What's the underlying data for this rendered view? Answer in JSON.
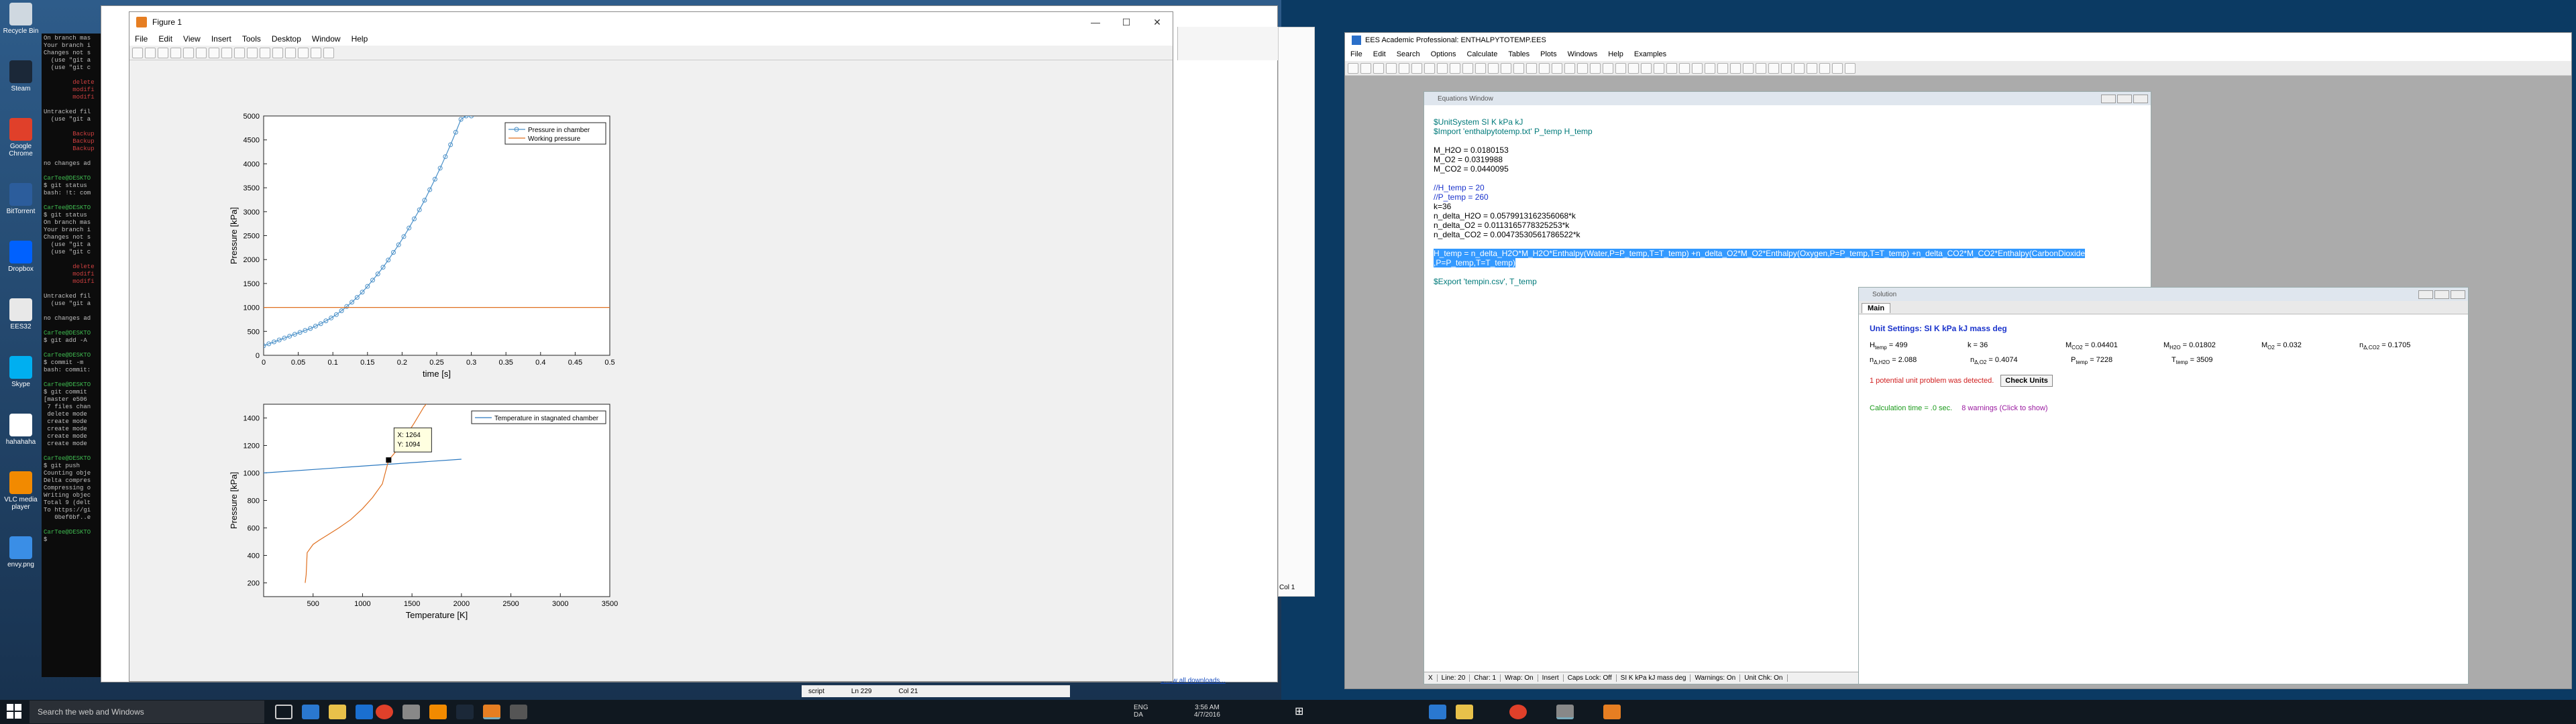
{
  "desktop_left": {
    "icons": [
      {
        "label": "Recycle Bin",
        "icon": "recycle-bin-icon",
        "color": "#cfd8e0"
      },
      {
        "label": "Steam",
        "icon": "steam-icon",
        "color": "#1b2838"
      },
      {
        "label": "Google Chrome",
        "icon": "chrome-icon",
        "color": "#e0402a"
      },
      {
        "label": "BitTorrent",
        "icon": "bittorrent-icon",
        "color": "#2c5d9c"
      },
      {
        "label": "Dropbox",
        "icon": "dropbox-icon",
        "color": "#0061fe"
      },
      {
        "label": "EES32",
        "icon": "ees32-icon",
        "color": "#e8e8e8"
      },
      {
        "label": "Skype",
        "icon": "skype-icon",
        "color": "#00aff0"
      },
      {
        "label": "hahahaha",
        "icon": "file-icon",
        "color": "#ffffff"
      },
      {
        "label": "VLC media player",
        "icon": "vlc-icon",
        "color": "#f28a00"
      },
      {
        "label": "envy.png",
        "icon": "image-file-icon",
        "color": "#3a8ee6"
      }
    ]
  },
  "terminal": {
    "lines": [
      {
        "t": "On branch mas",
        "c": ""
      },
      {
        "t": "Your branch i",
        "c": ""
      },
      {
        "t": "Changes not s",
        "c": ""
      },
      {
        "t": "  (use \"git a",
        "c": ""
      },
      {
        "t": "  (use \"git c",
        "c": ""
      },
      {
        "t": "",
        "c": ""
      },
      {
        "t": "        delete",
        "c": "r"
      },
      {
        "t": "        modifi",
        "c": "r"
      },
      {
        "t": "        modifi",
        "c": "r"
      },
      {
        "t": "",
        "c": ""
      },
      {
        "t": "Untracked fil",
        "c": ""
      },
      {
        "t": "  (use \"git a",
        "c": ""
      },
      {
        "t": "",
        "c": ""
      },
      {
        "t": "        Backup",
        "c": "r"
      },
      {
        "t": "        Backup",
        "c": "r"
      },
      {
        "t": "        Backup",
        "c": "r"
      },
      {
        "t": "",
        "c": ""
      },
      {
        "t": "no changes ad",
        "c": ""
      },
      {
        "t": "",
        "c": ""
      },
      {
        "t": "CarTee@DESKTO",
        "c": "g"
      },
      {
        "t": "$ git status",
        "c": ""
      },
      {
        "t": "bash: !t: com",
        "c": ""
      },
      {
        "t": "",
        "c": ""
      },
      {
        "t": "CarTee@DESKTO",
        "c": "g"
      },
      {
        "t": "$ git status",
        "c": ""
      },
      {
        "t": "On branch mas",
        "c": ""
      },
      {
        "t": "Your branch i",
        "c": ""
      },
      {
        "t": "Changes not s",
        "c": ""
      },
      {
        "t": "  (use \"git a",
        "c": ""
      },
      {
        "t": "  (use \"git c",
        "c": ""
      },
      {
        "t": "",
        "c": ""
      },
      {
        "t": "        delete",
        "c": "r"
      },
      {
        "t": "        modifi",
        "c": "r"
      },
      {
        "t": "        modifi",
        "c": "r"
      },
      {
        "t": "",
        "c": ""
      },
      {
        "t": "Untracked fil",
        "c": ""
      },
      {
        "t": "  (use \"git a",
        "c": ""
      },
      {
        "t": "",
        "c": ""
      },
      {
        "t": "no changes ad",
        "c": ""
      },
      {
        "t": "",
        "c": ""
      },
      {
        "t": "CarTee@DESKTO",
        "c": "g"
      },
      {
        "t": "$ git add -A",
        "c": ""
      },
      {
        "t": "",
        "c": ""
      },
      {
        "t": "CarTee@DESKTO",
        "c": "g"
      },
      {
        "t": "$ commit -m ",
        "c": ""
      },
      {
        "t": "bash: commit:",
        "c": ""
      },
      {
        "t": "",
        "c": ""
      },
      {
        "t": "CarTee@DESKTO",
        "c": "g"
      },
      {
        "t": "$ git commit",
        "c": ""
      },
      {
        "t": "[master e506",
        "c": ""
      },
      {
        "t": " 7 files chan",
        "c": ""
      },
      {
        "t": " delete mode",
        "c": ""
      },
      {
        "t": " create mode",
        "c": ""
      },
      {
        "t": " create mode",
        "c": ""
      },
      {
        "t": " create mode",
        "c": ""
      },
      {
        "t": " create mode",
        "c": ""
      },
      {
        "t": "",
        "c": ""
      },
      {
        "t": "CarTee@DESKTO",
        "c": "g"
      },
      {
        "t": "$ git push",
        "c": ""
      },
      {
        "t": "Counting obje",
        "c": ""
      },
      {
        "t": "Delta compres",
        "c": ""
      },
      {
        "t": "Compressing o",
        "c": ""
      },
      {
        "t": "Writing objec",
        "c": ""
      },
      {
        "t": "Total 9 (delt",
        "c": ""
      },
      {
        "t": "To https://gi",
        "c": ""
      },
      {
        "t": "   0bef0bf..e",
        "c": ""
      },
      {
        "t": "",
        "c": ""
      },
      {
        "t": "CarTee@DESKTO",
        "c": "g"
      },
      {
        "t": "$ ",
        "c": ""
      }
    ]
  },
  "matlab_figure": {
    "title": "Figure 1",
    "menu": [
      "File",
      "Edit",
      "View",
      "Insert",
      "Tools",
      "Desktop",
      "Window",
      "Help"
    ],
    "window_controls": [
      "—",
      "☐",
      "✕"
    ]
  },
  "chart_data": [
    {
      "type": "line",
      "xlabel": "time [s]",
      "ylabel": "Pressure [kPa]",
      "xlim": [
        0,
        0.5
      ],
      "ylim": [
        0,
        5000
      ],
      "xticks": [
        "0",
        "0.05",
        "0.1",
        "0.15",
        "0.2",
        "0.25",
        "0.3",
        "0.35",
        "0.4",
        "0.45",
        "0.5"
      ],
      "yticks": [
        "0",
        "500",
        "1000",
        "1500",
        "2000",
        "2500",
        "3000",
        "3500",
        "4000",
        "4500",
        "5000"
      ],
      "legend": "top-right",
      "series": [
        {
          "name": "Pressure in chamber",
          "color": "#4a90c8",
          "marker": "circle",
          "x": [
            0,
            0.0075,
            0.015,
            0.0225,
            0.03,
            0.0375,
            0.045,
            0.0525,
            0.06,
            0.0675,
            0.075,
            0.0825,
            0.09,
            0.0975,
            0.105,
            0.1125,
            0.12,
            0.1275,
            0.135,
            0.1425,
            0.15,
            0.1575,
            0.165,
            0.1725,
            0.18,
            0.1875,
            0.195,
            0.2025,
            0.21,
            0.2175,
            0.225,
            0.2325,
            0.24,
            0.2475,
            0.255,
            0.2625,
            0.27,
            0.2775,
            0.285,
            0.2925,
            0.3
          ],
          "y": [
            200,
            240,
            280,
            320,
            360,
            400,
            440,
            480,
            520,
            560,
            610,
            660,
            720,
            780,
            850,
            930,
            1020,
            1110,
            1210,
            1320,
            1440,
            1570,
            1700,
            1840,
            1990,
            2150,
            2310,
            2480,
            2660,
            2850,
            3040,
            3240,
            3460,
            3680,
            3910,
            4150,
            4400,
            4660,
            4930,
            5000,
            5000
          ]
        },
        {
          "name": "Working pressure",
          "color": "#e07020",
          "marker": "none",
          "x": [
            0,
            0.5
          ],
          "y": [
            1000,
            1000
          ]
        }
      ]
    },
    {
      "type": "line",
      "xlabel": "Temperature [K]",
      "ylabel": "Pressure [kPa]",
      "xlim": [
        0,
        3500
      ],
      "ylim": [
        100,
        1500
      ],
      "xticks": [
        "500",
        "1000",
        "1500",
        "2000",
        "2500",
        "3000",
        "3500"
      ],
      "yticks": [
        "200",
        "400",
        "600",
        "800",
        "1000",
        "1200",
        "1400"
      ],
      "legend": "top-right",
      "series": [
        {
          "name": "Temperature in stagnated chamber",
          "color": "#2a78c0",
          "marker": "none",
          "x": [
            0,
            2000
          ],
          "y": [
            1000,
            1100
          ]
        },
        {
          "name": "",
          "color": "#e07020",
          "marker": "none",
          "x": [
            420,
            430,
            440,
            500,
            560,
            650,
            760,
            880,
            1000,
            1100,
            1200,
            1264,
            1330,
            1420,
            1520,
            1620,
            1700
          ],
          "y": [
            200,
            260,
            420,
            480,
            510,
            550,
            600,
            660,
            740,
            820,
            920,
            1094,
            1150,
            1250,
            1360,
            1480,
            1550
          ]
        }
      ],
      "annotations": [
        {
          "x": "X: 1264",
          "y": "Y: 1094"
        }
      ]
    }
  ],
  "ees": {
    "title": "EES Academic Professional: ENTHALPYTOTEMP.EES",
    "menu": [
      "File",
      "Edit",
      "Search",
      "Options",
      "Calculate",
      "Tables",
      "Plots",
      "Windows",
      "Help",
      "Examples"
    ],
    "equations_window": {
      "title": "Equations Window",
      "lines": [
        {
          "t": "$UnitSystem SI K kPa kJ",
          "c": "teal"
        },
        {
          "t": "$Import 'enthalpytotemp.txt'  P_temp H_temp",
          "c": "teal"
        },
        {
          "t": "",
          "c": ""
        },
        {
          "t": "M_H2O = 0.0180153",
          "c": ""
        },
        {
          "t": "M_O2 = 0.0319988",
          "c": ""
        },
        {
          "t": "M_CO2 = 0.0440095",
          "c": ""
        },
        {
          "t": "",
          "c": ""
        },
        {
          "t": "//H_temp = 20",
          "c": "blue"
        },
        {
          "t": "//P_temp = 260",
          "c": "blue"
        },
        {
          "t": "k=36",
          "c": ""
        },
        {
          "t": "n_delta_H2O = 0.0579913162356068*k",
          "c": ""
        },
        {
          "t": "n_delta_O2  = 0.0113165778325253*k",
          "c": ""
        },
        {
          "t": "n_delta_CO2 = 0.00473530561786522*k",
          "c": ""
        },
        {
          "t": "",
          "c": ""
        },
        {
          "t": "H_temp = n_delta_H2O*M_H2O*Enthalpy(Water,P=P_temp,T=T_temp) +n_delta_O2*M_O2*Enthalpy(Oxygen,P=P_temp,T=T_temp) +n_delta_CO2*M_CO2*Enthalpy(CarbonDioxide",
          "c": "sel"
        },
        {
          "t": ",P=P_temp,T=T_temp)",
          "c": "sel"
        },
        {
          "t": "",
          "c": ""
        },
        {
          "t": "$Export 'tempin.csv', T_temp",
          "c": "teal"
        }
      ],
      "status": [
        "X",
        "Line: 20",
        "Char: 1",
        "Wrap: On",
        "Insert",
        "Caps Lock: Off",
        "SI K kPa kJ mass deg",
        "Warnings: On",
        "Unit Chk: On"
      ]
    },
    "solution_window": {
      "title": "Solution",
      "tab": "Main",
      "unit_settings": "Unit Settings: SI K kPa kJ mass deg",
      "rows": [
        [
          {
            "n": "H",
            "s": "temp",
            "v": " = 499"
          },
          {
            "n": "k",
            "s": "",
            "v": " = 36"
          },
          {
            "n": "M",
            "s": "CO2",
            "v": " = 0.04401"
          },
          {
            "n": "M",
            "s": "H2O",
            "v": " = 0.01802"
          },
          {
            "n": "M",
            "s": "O2",
            "v": " = 0.032"
          },
          {
            "n": "n",
            "s": "Δ,CO2",
            "v": " = 0.1705"
          }
        ],
        [
          {
            "n": "n",
            "s": "Δ,H2O",
            "v": " = 2.088"
          },
          {
            "n": "n",
            "s": "Δ,O2",
            "v": " = 0.4074"
          },
          {
            "n": "P",
            "s": "temp",
            "v": " = 7228"
          },
          {
            "n": "T",
            "s": "temp",
            "v": " = 3509"
          }
        ]
      ],
      "problem_text": "1 potential unit problem was detected.",
      "check_units": "Check Units",
      "calc_time": "Calculation time = .0 sec.",
      "warnings": "8 warnings  (Click to show)"
    }
  },
  "background_window": {
    "col_label": "Col 1",
    "status_left": "script",
    "status_ln": "Ln 229",
    "status_col": "Col 21",
    "downloads": "Show all downloads..."
  },
  "taskbar": {
    "search_placeholder": "Search the web and Windows",
    "lang1": "ENG",
    "lang2": "DA",
    "time": "3:56 AM",
    "date": "4/7/2016"
  }
}
